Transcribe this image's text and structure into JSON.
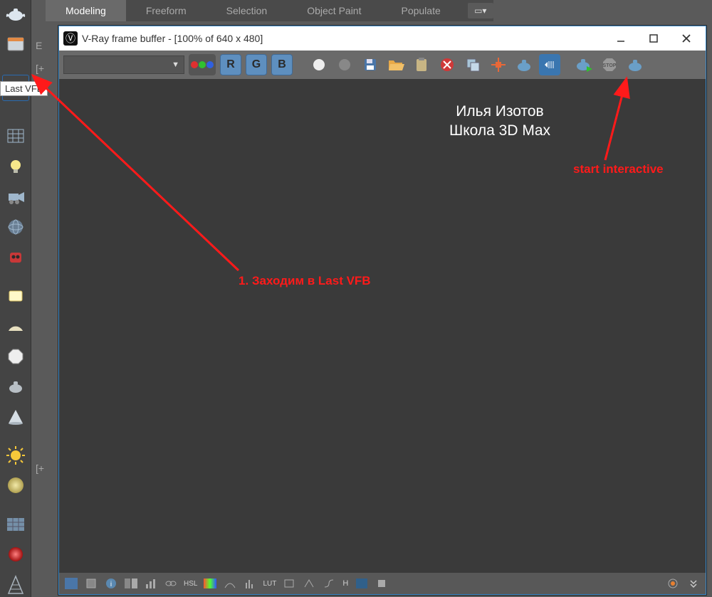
{
  "ribbon": {
    "tabs": [
      "Modeling",
      "Freeform",
      "Selection",
      "Object Paint",
      "Populate"
    ],
    "active_index": 0
  },
  "drawer_labels": {
    "l1": "E",
    "l2": "[+",
    "l3": "[+"
  },
  "tooltip": {
    "text": "Last VFB"
  },
  "vfb": {
    "title": "V-Ray frame buffer - [100% of 640 x 480]",
    "logo_char": "Ⓥ",
    "channels": {
      "R": "R",
      "G": "G",
      "B": "B"
    },
    "dropdown_arrow": "▼",
    "statusbar": {
      "hsl": "HSL",
      "lut": "LUT",
      "h": "H"
    }
  },
  "annotations": {
    "credit_line1": "Илья Изотов",
    "credit_line2": "Школа 3D Max",
    "step1": "1. Заходим в Last VFB",
    "start_interactive": "start interactive"
  }
}
